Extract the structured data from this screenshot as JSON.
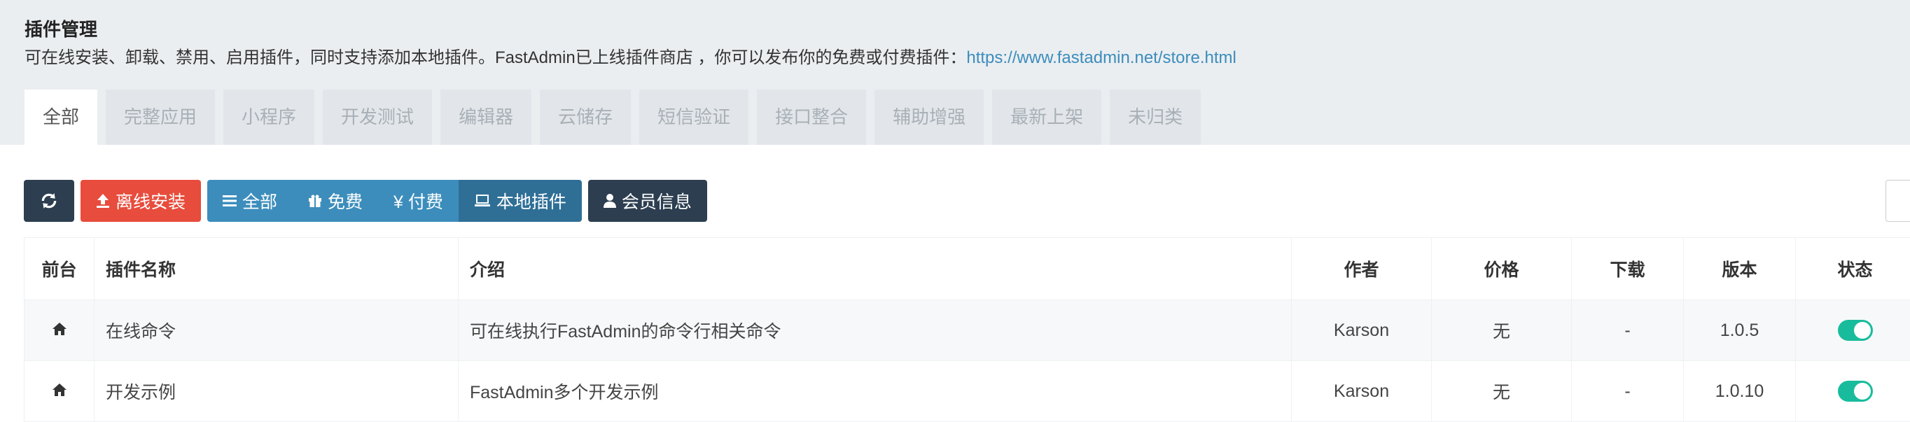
{
  "header": {
    "title": "插件管理",
    "description": "可在线安装、卸载、禁用、启用插件，同时支持添加本地插件。FastAdmin已上线插件商店 ，你可以发布你的免费或付费插件：",
    "store_link": "https://www.fastadmin.net/store.html"
  },
  "tabs": [
    {
      "label": "全部",
      "active": true
    },
    {
      "label": "完整应用"
    },
    {
      "label": "小程序"
    },
    {
      "label": "开发测试"
    },
    {
      "label": "编辑器"
    },
    {
      "label": "云储存"
    },
    {
      "label": "短信验证"
    },
    {
      "label": "接口整合"
    },
    {
      "label": "辅助增强"
    },
    {
      "label": "最新上架"
    },
    {
      "label": "未归类"
    }
  ],
  "toolbar": {
    "refresh_icon": "refresh-icon",
    "offline_install": "离线安装",
    "filter_all": "全部",
    "filter_free": "免费",
    "filter_paid": "¥ 付费",
    "filter_local": "本地插件",
    "member_info": "会员信息"
  },
  "table": {
    "columns": [
      "前台",
      "插件名称",
      "介绍",
      "作者",
      "价格",
      "下载",
      "版本",
      "状态"
    ],
    "rows": [
      {
        "frontend_icon": "home-icon",
        "name": "在线命令",
        "intro": "可在线执行FastAdmin的命令行相关命令",
        "author": "Karson",
        "price": "无",
        "downloads": "-",
        "version": "1.0.5",
        "enabled": true
      },
      {
        "frontend_icon": "home-icon",
        "name": "开发示例",
        "intro": "FastAdmin多个开发示例",
        "author": "Karson",
        "price": "无",
        "downloads": "-",
        "version": "1.0.10",
        "enabled": true
      }
    ]
  },
  "colors": {
    "accent_blue": "#3c8dbc",
    "danger_red": "#e74c3c",
    "dark": "#2c3e50",
    "success_green": "#18bc9c"
  }
}
